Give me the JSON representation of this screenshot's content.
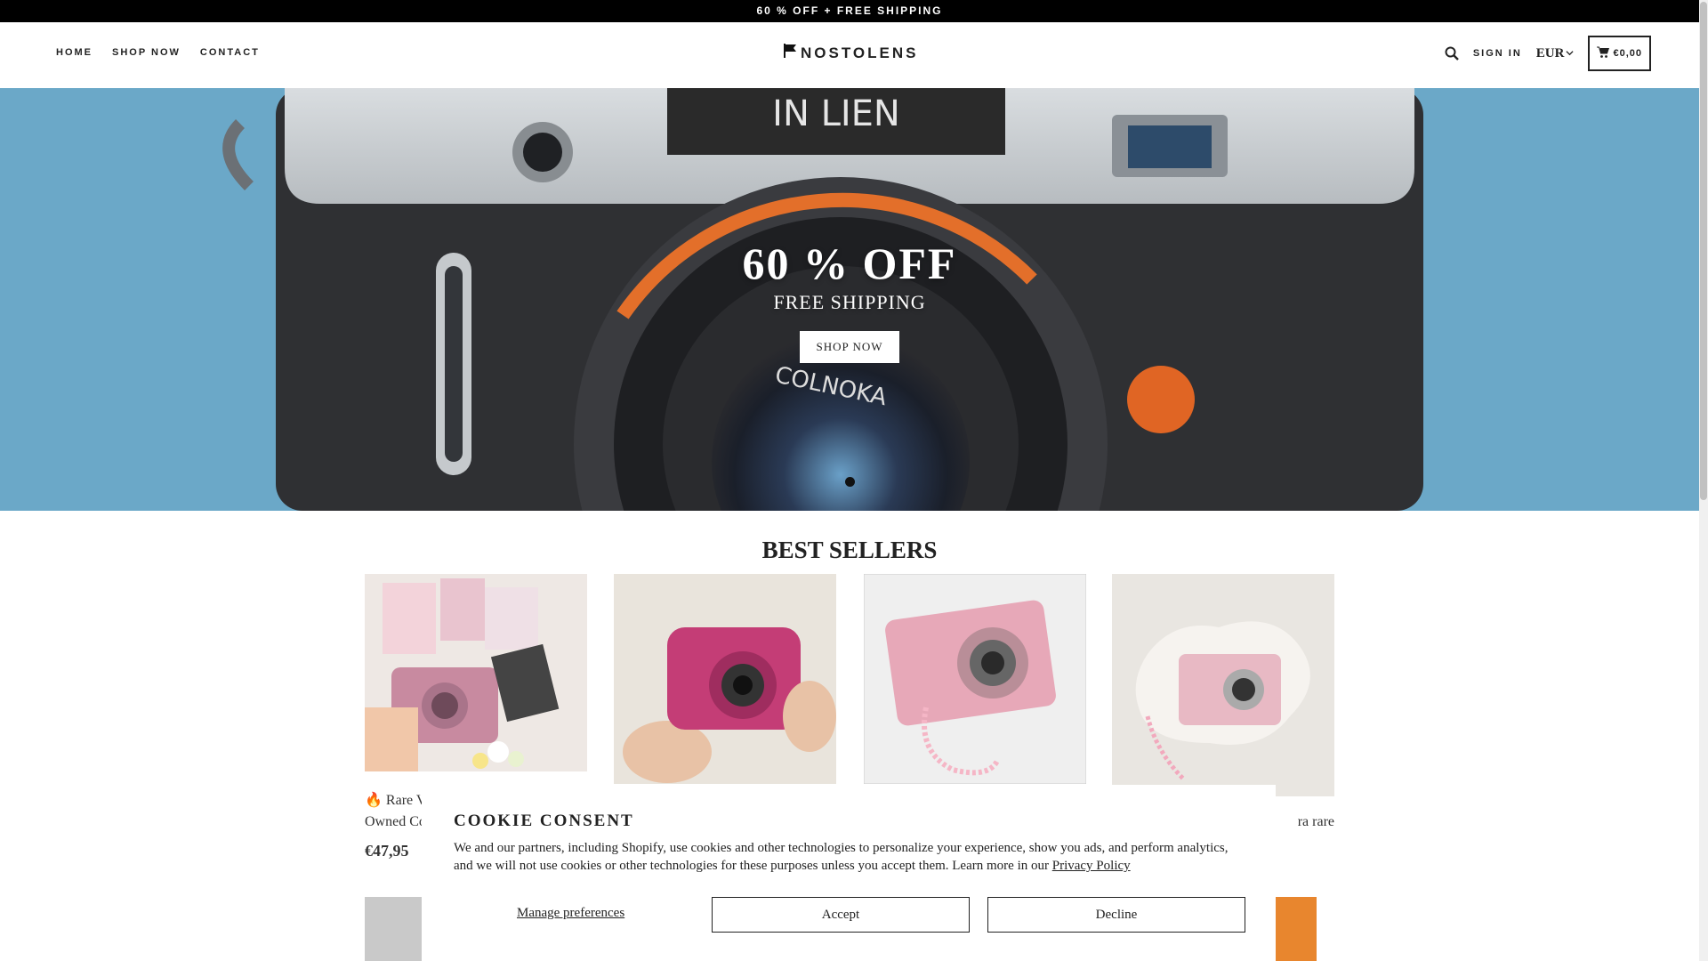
{
  "announcement": "60 % OFF + FREE SHIPPING",
  "nav": {
    "home": "HOME",
    "shop": "SHOP NOW",
    "contact": "CONTACT"
  },
  "logo": "NOSTOLENS",
  "header": {
    "signin": "SIGN IN",
    "currency": "EUR",
    "cart_total": "€0,00"
  },
  "hero": {
    "title": "60 % OFF",
    "subtitle": "FREE SHIPPING",
    "button": "SHOP NOW",
    "lens_text": "COLNOKA",
    "nameplate": "IN LIEN"
  },
  "best_sellers": {
    "title": "BEST SELLERS"
  },
  "products": [
    {
      "title_partial": "🔥 Rare V",
      "title_line2": "Owned Co",
      "price": "€47,95",
      "color": "#c98fa3"
    },
    {
      "title_partial": "",
      "color": "#c43d76"
    },
    {
      "title_partial": "",
      "color": "#e7a8b8"
    },
    {
      "title_partial": "ra rare",
      "color": "#e8b9c4"
    }
  ],
  "cookie": {
    "title": "COOKIE CONSENT",
    "text": "We and our partners, including Shopify, use cookies and other technologies to personalize your experience, show you ads, and perform analytics, and we will not use cookies or other technologies for these purposes unless you accept them. Learn more in our",
    "privacy_link": "Privacy Policy",
    "manage": "Manage preferences",
    "accept": "Accept",
    "decline": "Decline"
  },
  "colors": {
    "hero_bg": "#6aa6c6",
    "accent_orange": "#e36f2a"
  }
}
